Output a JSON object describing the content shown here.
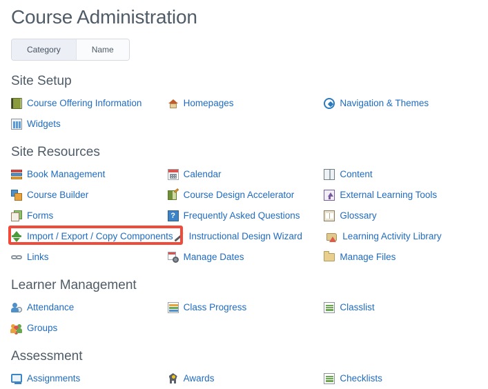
{
  "page": {
    "title": "Course Administration"
  },
  "toggle": {
    "options": [
      {
        "label": "Category",
        "selected": true
      },
      {
        "label": "Name",
        "selected": false
      }
    ]
  },
  "colors": {
    "link": "#1f6bc0",
    "heading": "#4f5b66",
    "highlight": "#ef4a3a",
    "page_background": "#ffffff"
  },
  "highlight": {
    "target_label": "Import / Export / Copy Components",
    "border_color": "#ef4a3a"
  },
  "sections": [
    {
      "heading": "Site Setup",
      "rows": [
        [
          {
            "label": "Course Offering Information",
            "icon": "green-book-icon"
          },
          {
            "label": "Homepages",
            "icon": "house-icon"
          },
          {
            "label": "Navigation & Themes",
            "icon": "compass-icon"
          }
        ],
        [
          {
            "label": "Widgets",
            "icon": "widgets-icon"
          },
          {
            "label": "",
            "icon": ""
          },
          {
            "label": "",
            "icon": ""
          }
        ]
      ]
    },
    {
      "heading": "Site Resources",
      "rows": [
        [
          {
            "label": "Book Management",
            "icon": "stacked-books-icon"
          },
          {
            "label": "Calendar",
            "icon": "calendar-icon"
          },
          {
            "label": "Content",
            "icon": "open-book-icon"
          }
        ],
        [
          {
            "label": "Course Builder",
            "icon": "layered-squares-icon"
          },
          {
            "label": "Course Design Accelerator",
            "icon": "chalkboard-pencil-icon"
          },
          {
            "label": "External Learning Tools",
            "icon": "external-tools-icon"
          }
        ],
        [
          {
            "label": "Forms",
            "icon": "forms-icon"
          },
          {
            "label": "Frequently Asked Questions",
            "icon": "question-mark-icon"
          },
          {
            "label": "Glossary",
            "icon": "glossary-book-icon"
          }
        ],
        [
          {
            "label": "Import / Export / Copy Components",
            "icon": "up-down-arrows-icon"
          },
          {
            "label": "Instructional Design Wizard",
            "icon": "magic-wand-icon"
          },
          {
            "label": "Learning Activity Library",
            "icon": "library-icon"
          }
        ],
        [
          {
            "label": "Links",
            "icon": "chain-link-icon"
          },
          {
            "label": "Manage Dates",
            "icon": "calendar-gear-icon"
          },
          {
            "label": "Manage Files",
            "icon": "folder-icon"
          }
        ]
      ]
    },
    {
      "heading": "Learner Management",
      "rows": [
        [
          {
            "label": "Attendance",
            "icon": "person-clock-icon"
          },
          {
            "label": "Class Progress",
            "icon": "progress-bars-icon"
          },
          {
            "label": "Classlist",
            "icon": "classlist-icon"
          }
        ],
        [
          {
            "label": "Groups",
            "icon": "people-group-icon"
          },
          {
            "label": "",
            "icon": ""
          },
          {
            "label": "",
            "icon": ""
          }
        ]
      ]
    },
    {
      "heading": "Assessment",
      "rows": [
        [
          {
            "label": "Assignments",
            "icon": "monitor-icon"
          },
          {
            "label": "Awards",
            "icon": "medal-icon"
          },
          {
            "label": "Checklists",
            "icon": "checklist-icon"
          }
        ]
      ]
    }
  ]
}
